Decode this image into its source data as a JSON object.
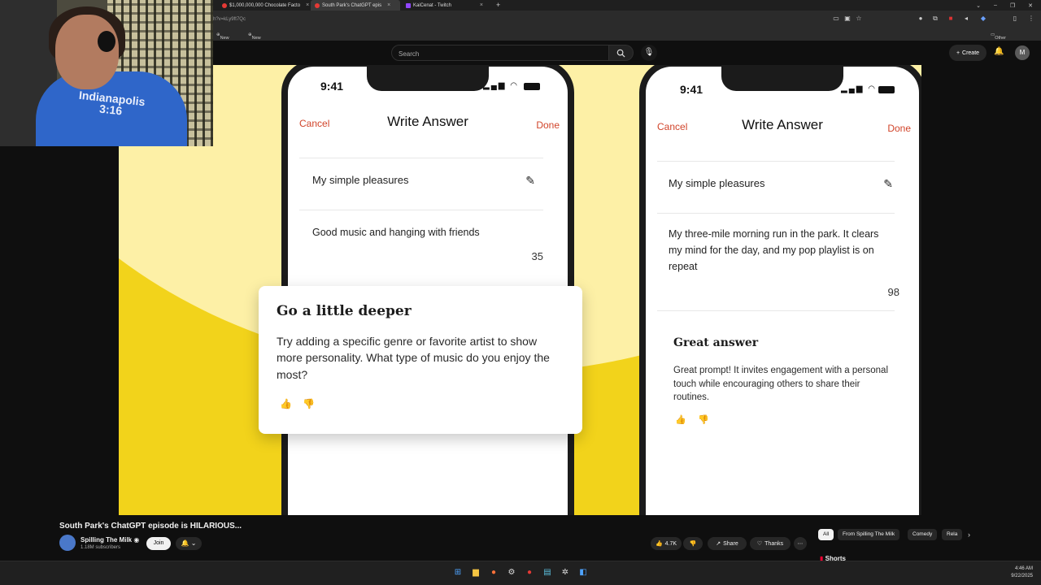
{
  "browser": {
    "tabs": [
      {
        "title": "$1,000,000,000 Chocolate Facto",
        "active": false
      },
      {
        "title": "South Park's ChatGPT epis",
        "active": true
      },
      {
        "title": "KaiCenat - Twitch",
        "active": false
      }
    ],
    "new_tab_symbol": "+",
    "url": "h?v=kLy9ft7Qc",
    "bookmarks": [
      "New Tab",
      "New Tab"
    ],
    "other_bookmarks": "Other Bookmarks"
  },
  "youtube": {
    "search_placeholder": "Search",
    "create_label": "Create",
    "avatar_initial": "M"
  },
  "video": {
    "phone_left": {
      "time": "9:41",
      "cancel": "Cancel",
      "title": "Write Answer",
      "done": "Done",
      "prompt": "My simple pleasures",
      "answer": "Good music and hanging with friends",
      "count": "35",
      "card_title": "Go a little deeper",
      "card_body": "Try adding a specific genre or favorite artist to show more personality. What type of music do you enjoy the most?"
    },
    "phone_right": {
      "time": "9:41",
      "cancel": "Cancel",
      "title": "Write Answer",
      "done": "Done",
      "prompt": "My simple pleasures",
      "answer": "My three-mile morning run in the park. It clears my mind for the day, and my pop playlist is on repeat",
      "count": "98",
      "feedback_title": "Great answer",
      "feedback_body": "Great prompt! It invites engagement with a personal touch while encouraging others to share their routines."
    }
  },
  "webcam": {
    "shirt_text_line1": "Indianapolis",
    "shirt_text_line2": "3:16"
  },
  "video_info": {
    "title": "South Park's ChatGPT episode is HILARIOUS...",
    "channel": "Spilling The Milk",
    "subscribers": "1.18M subscribers",
    "join_label": "Join",
    "likes": "4.7K",
    "share_label": "Share",
    "thanks_label": "Thanks",
    "chips": [
      "All",
      "From Spilling The Milk",
      "Comedy",
      "Rela"
    ],
    "shorts_label": "Shorts"
  },
  "taskbar": {
    "time": "4:46 AM",
    "date": "9/22/2025"
  },
  "colors": {
    "accent_red": "#d1442a",
    "video_yellow": "#f2d31b",
    "yt_bg": "#0f0f0f"
  }
}
